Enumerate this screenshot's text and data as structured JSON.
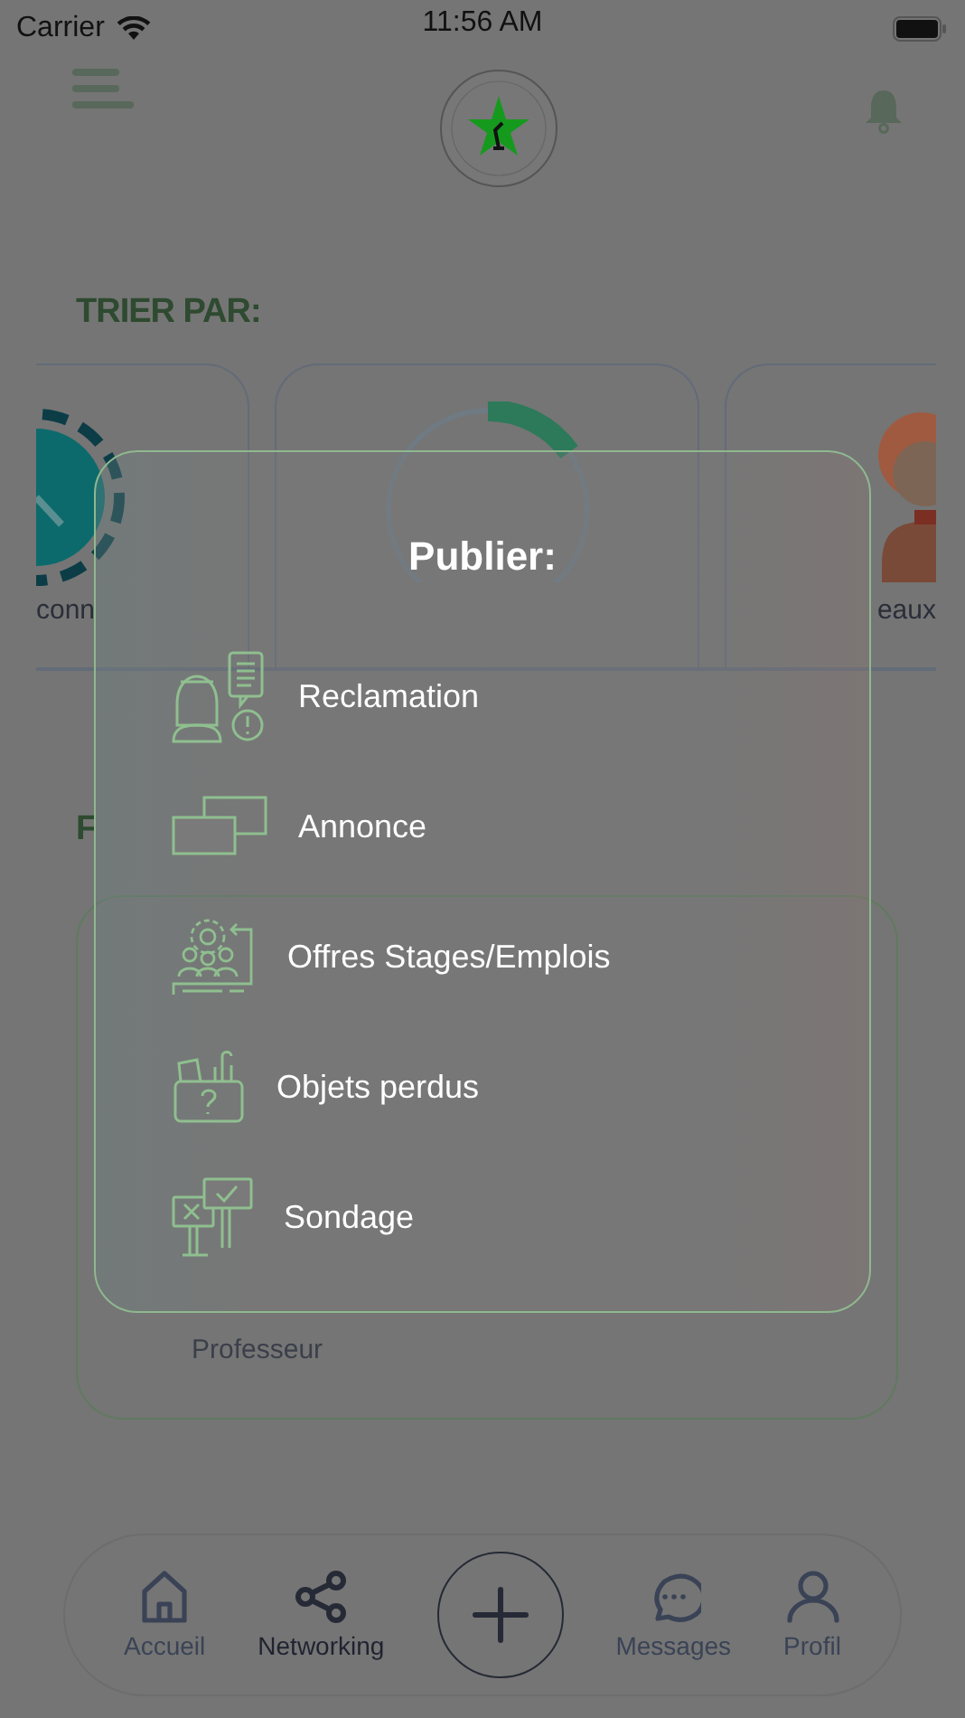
{
  "status_bar": {
    "carrier": "Carrier",
    "time": "11:56 AM"
  },
  "sort": {
    "title": "TRIER PAR:",
    "cards": [
      {
        "kind": "clock",
        "label": "conn"
      },
      {
        "kind": "ring"
      },
      {
        "kind": "person",
        "label": "eaux"
      }
    ]
  },
  "section_title": "F",
  "profile_card": {
    "role": "Professeur"
  },
  "modal": {
    "title": "Publier:",
    "items": [
      {
        "kind": "complaint",
        "label": "Reclamation"
      },
      {
        "kind": "windows",
        "label": "Annonce"
      },
      {
        "kind": "team",
        "label": "Offres Stages/Emplois"
      },
      {
        "kind": "lost",
        "label": "Objets perdus"
      },
      {
        "kind": "poll",
        "label": "Sondage"
      }
    ]
  },
  "nav": {
    "items": [
      {
        "kind": "home",
        "label": "Accueil",
        "selected": false
      },
      {
        "kind": "share",
        "label": "Networking",
        "selected": true
      },
      {
        "kind": "add"
      },
      {
        "kind": "chat",
        "label": "Messages",
        "selected": false
      },
      {
        "kind": "user",
        "label": "Profil",
        "selected": false
      }
    ]
  }
}
